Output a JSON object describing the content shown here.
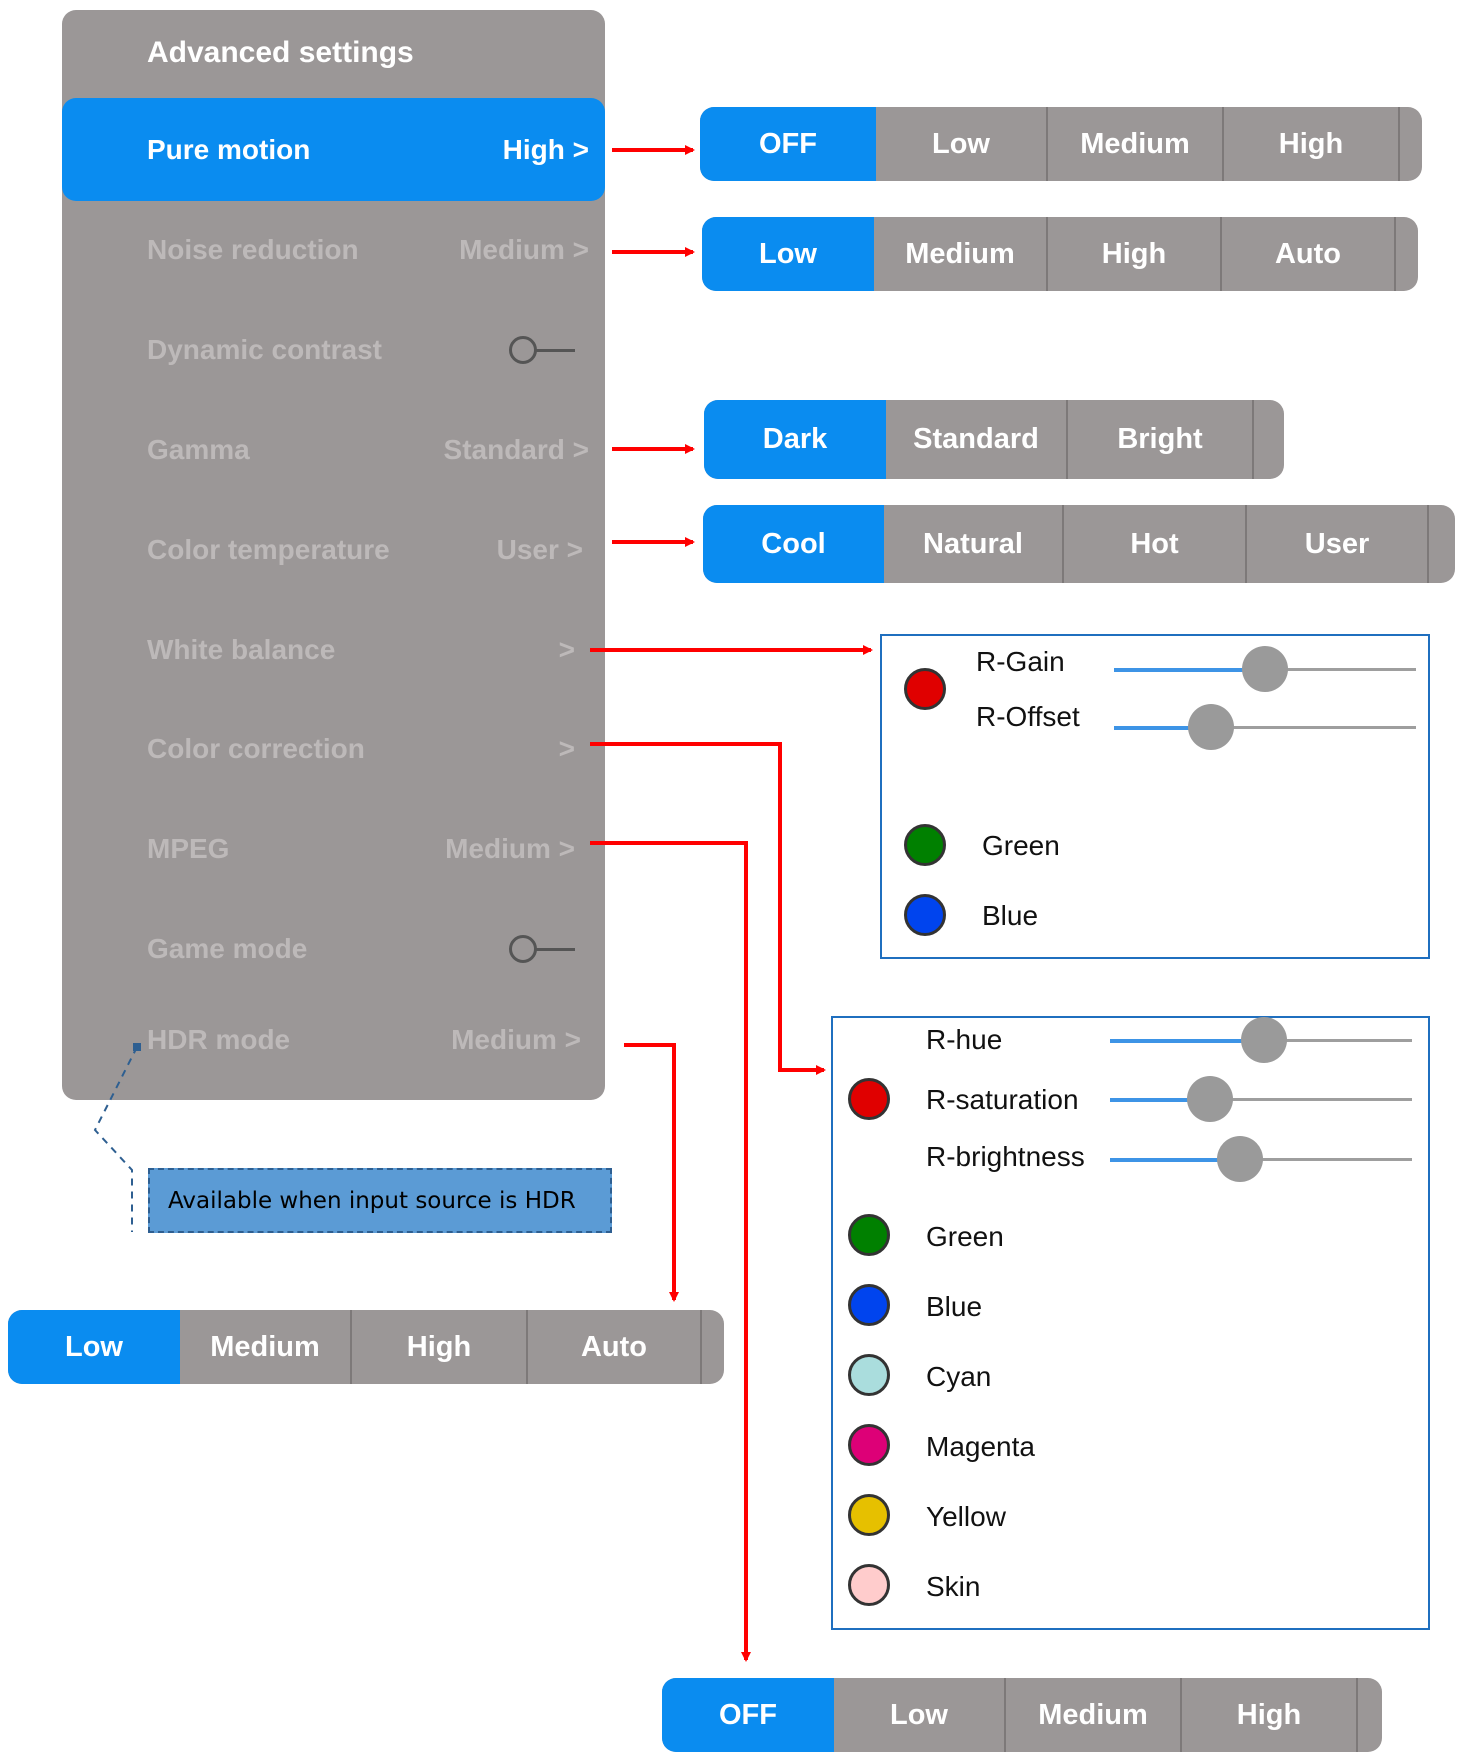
{
  "panel": {
    "title": "Advanced settings",
    "items": [
      {
        "label": "Pure motion",
        "value": "High >"
      },
      {
        "label": "Noise reduction",
        "value": "Medium >"
      },
      {
        "label": "Dynamic contrast"
      },
      {
        "label": "Gamma",
        "value": "Standard >"
      },
      {
        "label": "Color temperature",
        "value": "User >"
      },
      {
        "label": "White balance",
        "value": ">"
      },
      {
        "label": "Color correction",
        "value": ">"
      },
      {
        "label": "MPEG",
        "value": "Medium >"
      },
      {
        "label": "Game mode"
      },
      {
        "label": "HDR mode",
        "value": "Medium >"
      }
    ]
  },
  "pure_motion_options": [
    "OFF",
    "Low",
    "Medium",
    "High"
  ],
  "noise_reduction_options": [
    "Low",
    "Medium",
    "High",
    "Auto"
  ],
  "gamma_options": [
    "Dark",
    "Standard",
    "Bright"
  ],
  "color_temperature_options": [
    "Cool",
    "Natural",
    "Hot",
    "User"
  ],
  "white_balance": {
    "r_gain_label": "R-Gain",
    "r_gain_value": 0.5,
    "r_offset_label": "R-Offset",
    "r_offset_value": 0.32,
    "green_label": "Green",
    "blue_label": "Blue"
  },
  "color_correction": {
    "r_hue_label": "R-hue",
    "r_hue_value": 0.51,
    "r_saturation_label": "R-saturation",
    "r_saturation_value": 0.33,
    "r_brightness_label": "R-brightness",
    "r_brightness_value": 0.43,
    "colors": [
      "Green",
      "Blue",
      "Cyan",
      "Magenta",
      "Yellow",
      "Skin"
    ]
  },
  "hdr_note": "Available when input source is HDR",
  "hdr_options": [
    "Low",
    "Medium",
    "High",
    "Auto"
  ],
  "mpeg_options": [
    "OFF",
    "Low",
    "Medium",
    "High"
  ],
  "colors": {
    "accent": "#0a8cf0",
    "panel_bg": "#9b9797",
    "arrow": "#ff0000",
    "red": "#e00000",
    "green": "#008000",
    "blue": "#0044ee",
    "cyan": "#aadddd",
    "magenta": "#dd0077",
    "yellow": "#e6c000",
    "skin": "#ffcccc"
  }
}
